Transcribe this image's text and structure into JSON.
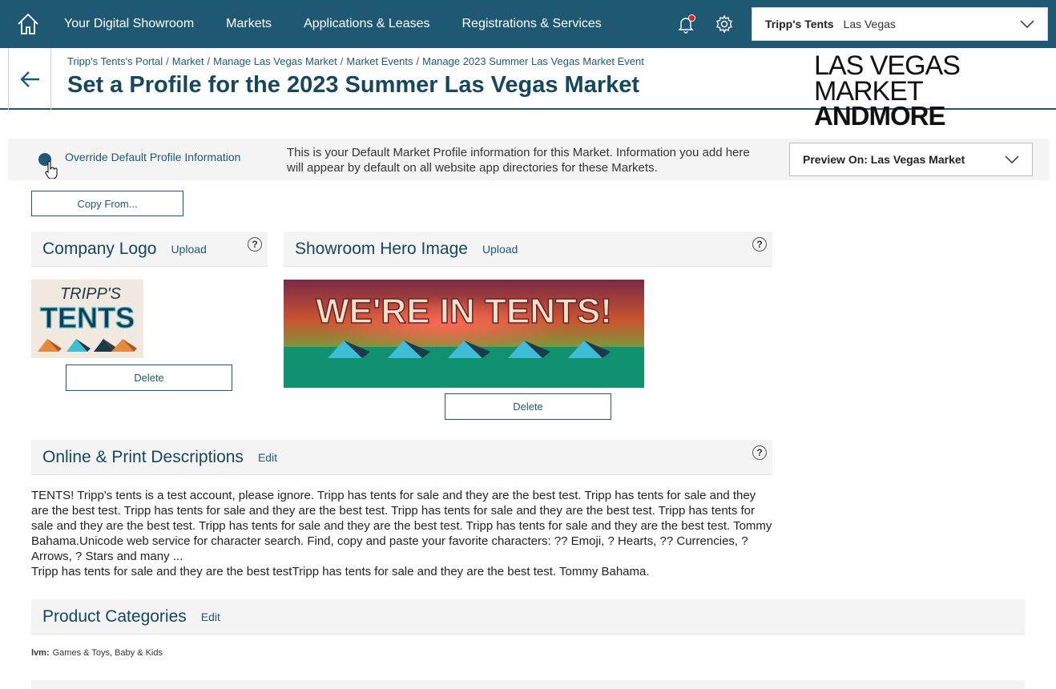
{
  "nav": {
    "items": [
      "Your Digital Showroom",
      "Markets",
      "Applications & Leases",
      "Registrations & Services"
    ],
    "account_name": "Tripp's Tents",
    "account_city": "Las Vegas"
  },
  "header": {
    "breadcrumb": [
      "Tripp's Tents's Portal",
      "Market",
      "Manage Las Vegas Market",
      "Market Events",
      "Manage 2023 Summer Las Vegas Market Event"
    ],
    "title": "Set a Profile for the 2023 Summer Las Vegas Market",
    "logo_line1": "LAS VEGAS MARKET",
    "logo_line2": "ANDMORE"
  },
  "override": {
    "label": "Override Default Profile Information",
    "info": "This is your Default Market Profile information for this Market. Information you add here will appear by default on all website app directories for these Markets.",
    "preview_label": "Preview On: Las Vegas Market"
  },
  "copy_button": "Copy From...",
  "company_logo": {
    "title": "Company Logo",
    "upload": "Upload",
    "delete": "Delete",
    "image_text_line1": "TRIPP'S",
    "image_text_line2": "TENTS"
  },
  "hero_image": {
    "title": "Showroom Hero Image",
    "upload": "Upload",
    "delete": "Delete",
    "image_text": "WE'RE IN TENTS!"
  },
  "descriptions": {
    "title": "Online & Print Descriptions",
    "edit": "Edit",
    "text1": "TENTS! Tripp's tents is a test account, please ignore. Tripp has tents for sale and they are the best test. Tripp has tents for sale and they are the best test. Tripp has tents for sale and they are the best test. Tripp has tents for sale and they are the best test. Tripp has tents for sale and they are the best test. Tripp has tents for sale and they are the best test. Tripp has tents for sale and they are the best test. Tommy Bahama.Unicode web service for character search. Find, copy and paste your favorite characters: ?? Emoji, ? Hearts, ?? Currencies, ? Arrows, ? Stars and many ...",
    "text2": "Tripp has tents for sale and they are the best testTripp has tents for sale and they are the best test. Tommy Bahama."
  },
  "product_categories": {
    "title": "Product Categories",
    "edit": "Edit",
    "market_code": "lvm:",
    "categories": "Games & Toys, Baby & Kids"
  },
  "help_glyph": "?",
  "colors": {
    "nav_bg": "#1f5872",
    "title": "#15475e",
    "notification": "#d21f1f"
  }
}
